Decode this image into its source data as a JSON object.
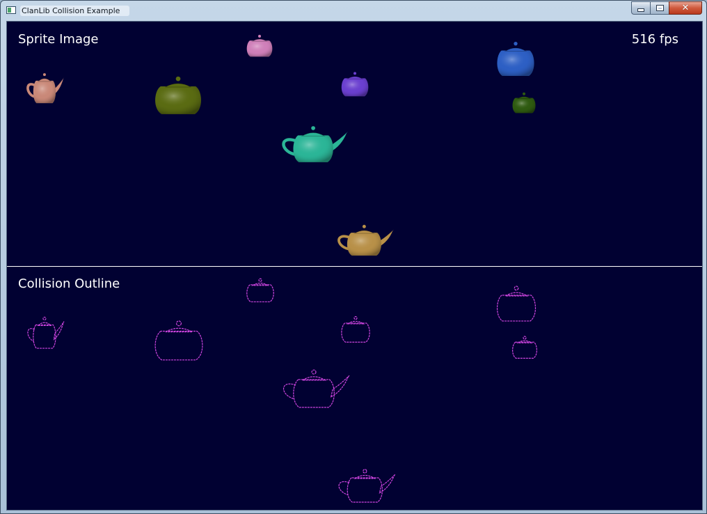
{
  "window": {
    "title": "ClanLib Collision Example",
    "minimize_label": "minimize",
    "maximize_label": "maximize",
    "close_label": "close"
  },
  "sprite_view": {
    "label": "Sprite Image",
    "fps_value": "516",
    "fps_unit": "fps"
  },
  "collision_view": {
    "label": "Collision Outline",
    "outline_color": "#cc44dd"
  },
  "teapots": [
    {
      "color": "#c98878",
      "icon": "teapot-salmon"
    },
    {
      "color": "#cf7fb9",
      "icon": "teapot-pink"
    },
    {
      "color": "#5a6b12",
      "icon": "teapot-olive"
    },
    {
      "color": "#6a3fcf",
      "icon": "teapot-purple"
    },
    {
      "color": "#2d5fc4",
      "icon": "teapot-blue"
    },
    {
      "color": "#2e5a10",
      "icon": "teapot-green"
    },
    {
      "color": "#2bb597",
      "icon": "teapot-teal"
    },
    {
      "color": "#b89048",
      "icon": "teapot-gold"
    }
  ]
}
